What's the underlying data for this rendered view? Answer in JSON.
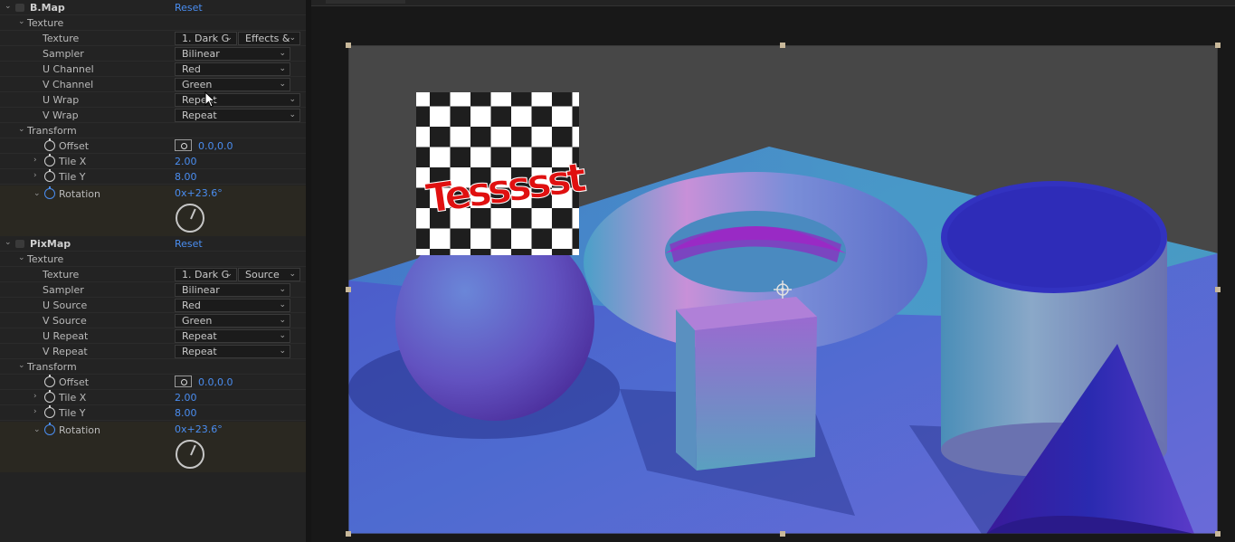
{
  "effects": [
    {
      "name": "B.Map",
      "reset_label": "Reset",
      "texture_group": "Texture",
      "texture_label": "Texture",
      "texture_value": "1. Dark G",
      "texture_source": "Effects &",
      "rows": [
        {
          "label": "Sampler",
          "value": "Bilinear"
        },
        {
          "label": "U Channel",
          "value": "Red"
        },
        {
          "label": "V Channel",
          "value": "Green"
        },
        {
          "label": "U Wrap",
          "value": "Repeat"
        },
        {
          "label": "V Wrap",
          "value": "Repeat"
        }
      ],
      "transform_group": "Transform",
      "offset_label": "Offset",
      "offset_value": "0.0,0.0",
      "tilex_label": "Tile X",
      "tilex_value": "2.00",
      "tiley_label": "Tile Y",
      "tiley_value": "8.00",
      "rotation_label": "Rotation",
      "rotation_value": "0x+23.6°"
    },
    {
      "name": "PixMap",
      "reset_label": "Reset",
      "texture_group": "Texture",
      "texture_label": "Texture",
      "texture_value": "1. Dark G",
      "texture_source": "Source",
      "rows": [
        {
          "label": "Sampler",
          "value": "Bilinear"
        },
        {
          "label": "U Source",
          "value": "Red"
        },
        {
          "label": "V Source",
          "value": "Green"
        },
        {
          "label": "U Repeat",
          "value": "Repeat"
        },
        {
          "label": "V Repeat",
          "value": "Repeat"
        }
      ],
      "transform_group": "Transform",
      "offset_label": "Offset",
      "offset_value": "0.0,0.0",
      "tilex_label": "Tile X",
      "tilex_value": "2.00",
      "tiley_label": "Tile Y",
      "tiley_value": "8.00",
      "rotation_label": "Rotation",
      "rotation_value": "0x+23.6°"
    }
  ],
  "scene": {
    "texture_text": "Tessssst"
  },
  "colors": {
    "accent_blue": "#4a8df0",
    "panel_bg": "#232323",
    "keyframe_bg": "#2a2821"
  }
}
